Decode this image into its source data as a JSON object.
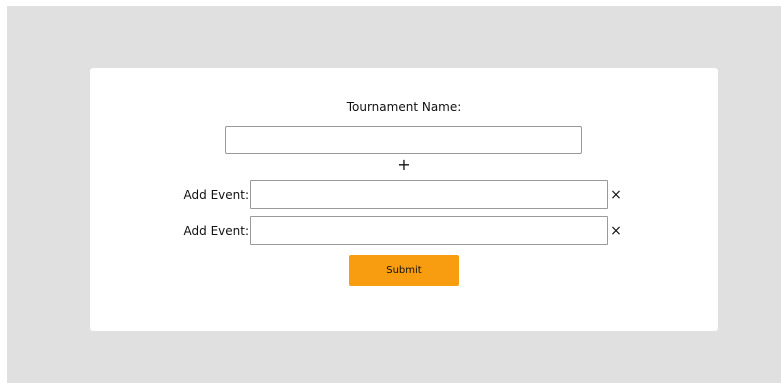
{
  "form": {
    "tournament_name_label": "Tournament Name:",
    "tournament_name_value": "",
    "add_event_symbol": "+",
    "events": [
      {
        "label": "Add Event:",
        "value": "",
        "remove_symbol": "×"
      },
      {
        "label": "Add Event:",
        "value": "",
        "remove_symbol": "×"
      }
    ],
    "submit_label": "Submit"
  },
  "colors": {
    "page_background": "#e0e0e0",
    "card_background": "#ffffff",
    "submit_background": "#f99d10"
  }
}
